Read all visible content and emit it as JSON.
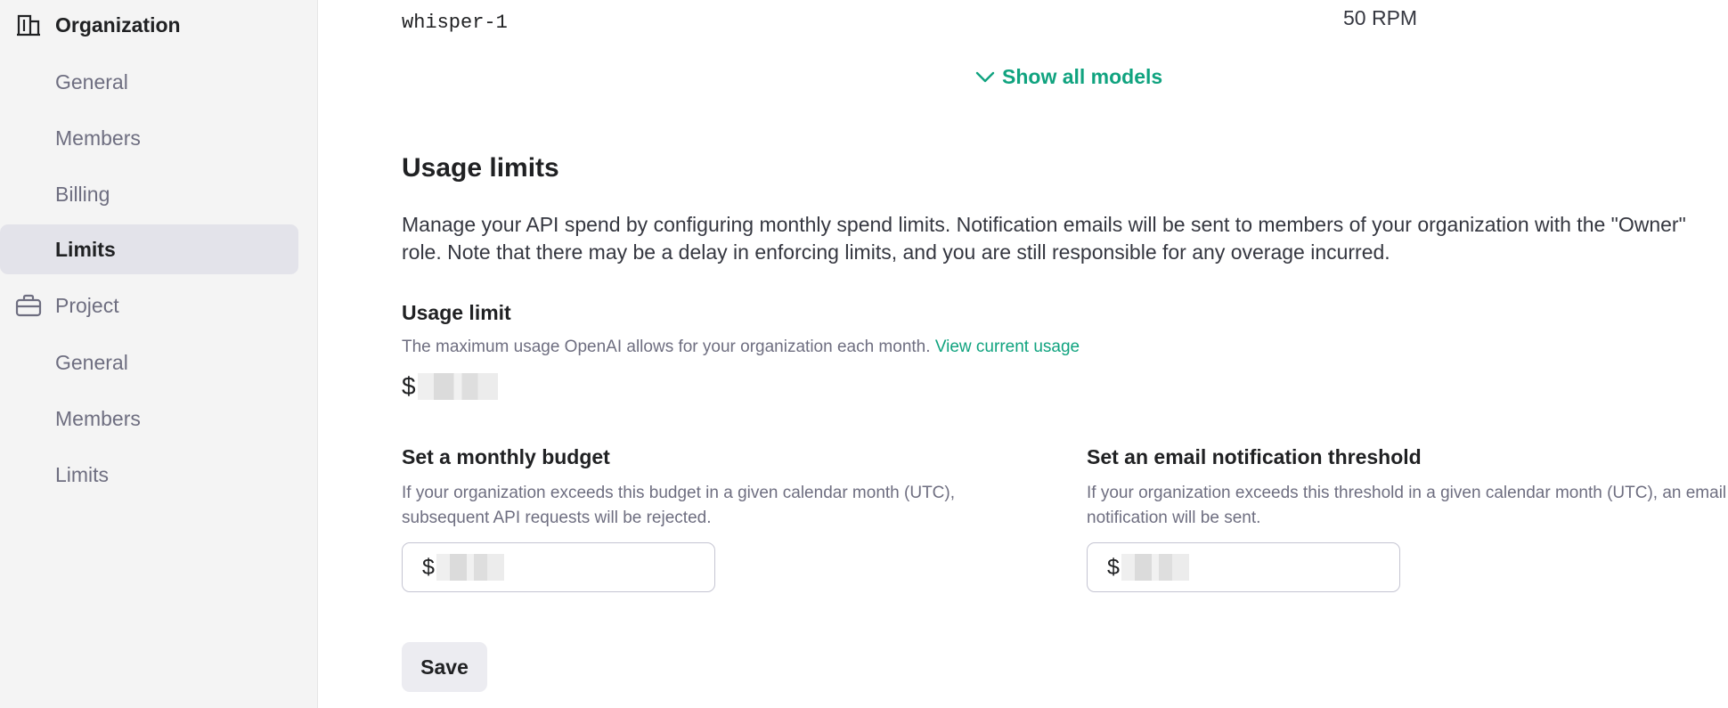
{
  "sidebar": {
    "organization": {
      "label": "Organization",
      "icon": "building-icon",
      "items": [
        {
          "label": "General"
        },
        {
          "label": "Members"
        },
        {
          "label": "Billing"
        },
        {
          "label": "Limits",
          "active": true
        }
      ]
    },
    "project": {
      "label": "Project",
      "icon": "briefcase-icon",
      "items": [
        {
          "label": "General"
        },
        {
          "label": "Members"
        },
        {
          "label": "Limits"
        }
      ]
    }
  },
  "models": {
    "last_row": {
      "name": "whisper-1",
      "limit": "50 RPM"
    },
    "show_all_label": "Show all models"
  },
  "usage_limits": {
    "heading": "Usage limits",
    "description": "Manage your API spend by configuring monthly spend limits. Notification emails will be sent to members of your organization with the \"Owner\" role. Note that there may be a delay in enforcing limits, and you are still responsible for any overage incurred.",
    "usage_limit": {
      "heading": "Usage limit",
      "subtitle": "The maximum usage OpenAI allows for your organization each month.",
      "link": "View current usage",
      "currency": "$"
    },
    "budget": {
      "heading": "Set a monthly budget",
      "subtitle": "If your organization exceeds this budget in a given calendar month (UTC), subsequent API requests will be rejected.",
      "currency": "$"
    },
    "threshold": {
      "heading": "Set an email notification threshold",
      "subtitle": "If your organization exceeds this threshold in a given calendar month (UTC), an email notification will be sent.",
      "currency": "$"
    },
    "save_label": "Save"
  },
  "colors": {
    "accent": "#10a37f",
    "sidebar_bg": "#f4f4f4",
    "active_item_bg": "#e3e3ea"
  }
}
